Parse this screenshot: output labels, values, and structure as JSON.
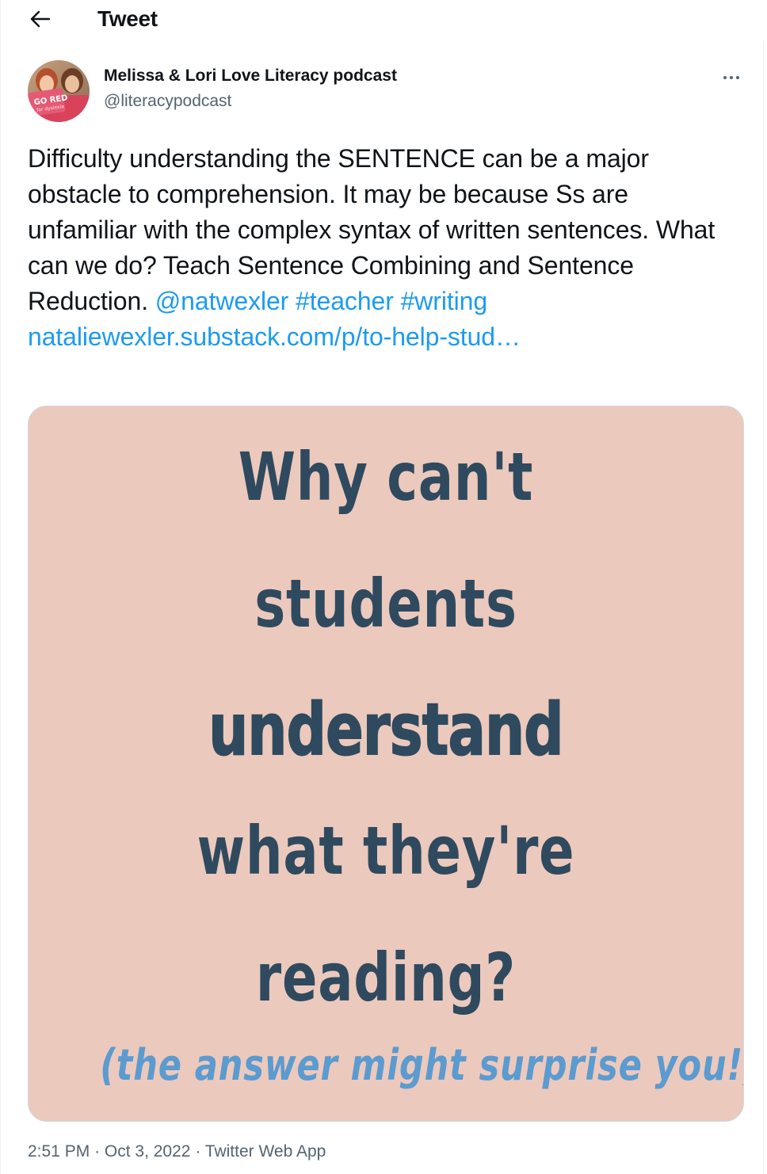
{
  "header": {
    "back_icon": "arrow-left-icon",
    "title": "Tweet"
  },
  "author": {
    "name": "Melissa & Lori Love Literacy podcast",
    "handle": "@literacypodcast",
    "avatar_sign_text": "GO RED",
    "avatar_sign_subtext": "for dyslexia"
  },
  "more_icon": "more-horizontal-icon",
  "tweet": {
    "text": "Difficulty understanding the SENTENCE can be a major obstacle to comprehension. It may be because Ss are unfamiliar with the complex syntax of written sentences. What can we do? Teach Sentence Combining and Sentence Reduction.",
    "mention": "@natwexler",
    "hashtag_1": "#teacher",
    "hashtag_2": "#writing",
    "link": "nataliewexler.substack.com/p/to-help-stud…"
  },
  "media": {
    "line_1": "Why can't",
    "line_2": "students",
    "line_3": "understand",
    "line_4": "what they're",
    "line_5": "reading?",
    "line_6": "(the answer might surprise you!)",
    "background_color": "#ecc9bd",
    "text_color": "#2f4a5e",
    "accent_color": "#5b9bd0"
  },
  "meta": {
    "time": "2:51 PM",
    "date": "Oct 3, 2022",
    "source": "Twitter Web App",
    "separator": "·"
  },
  "colors": {
    "link": "#1d9bf0",
    "secondary_text": "#536471"
  }
}
